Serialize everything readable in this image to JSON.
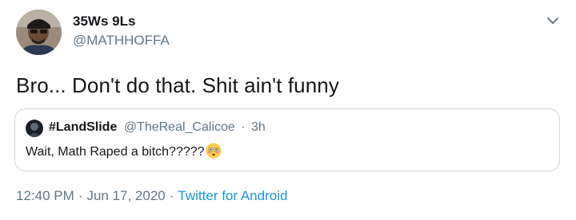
{
  "tweet": {
    "author": {
      "name": "35Ws 9Ls",
      "handle": "@MATHHOFFA",
      "avatar_icon": "user-avatar-photo"
    },
    "text": "Bro... Don't do that. Shit ain't funny",
    "menu_icon": "chevron-down-icon",
    "quoted": {
      "name": "#LandSlide",
      "handle": "@TheReal_Calicoe",
      "separator": "·",
      "time": "3h",
      "text": "Wait, Math Raped a bitch?????",
      "emoji": "flushed-face-emoji"
    },
    "meta": {
      "time": "12:40 PM",
      "separator1": "·",
      "date": "Jun 17, 2020",
      "separator2": "·",
      "source": "Twitter for Android"
    }
  },
  "colors": {
    "text_primary": "#14171a",
    "text_secondary": "#657786",
    "link": "#1b95e0",
    "border": "#ccd6dd"
  }
}
